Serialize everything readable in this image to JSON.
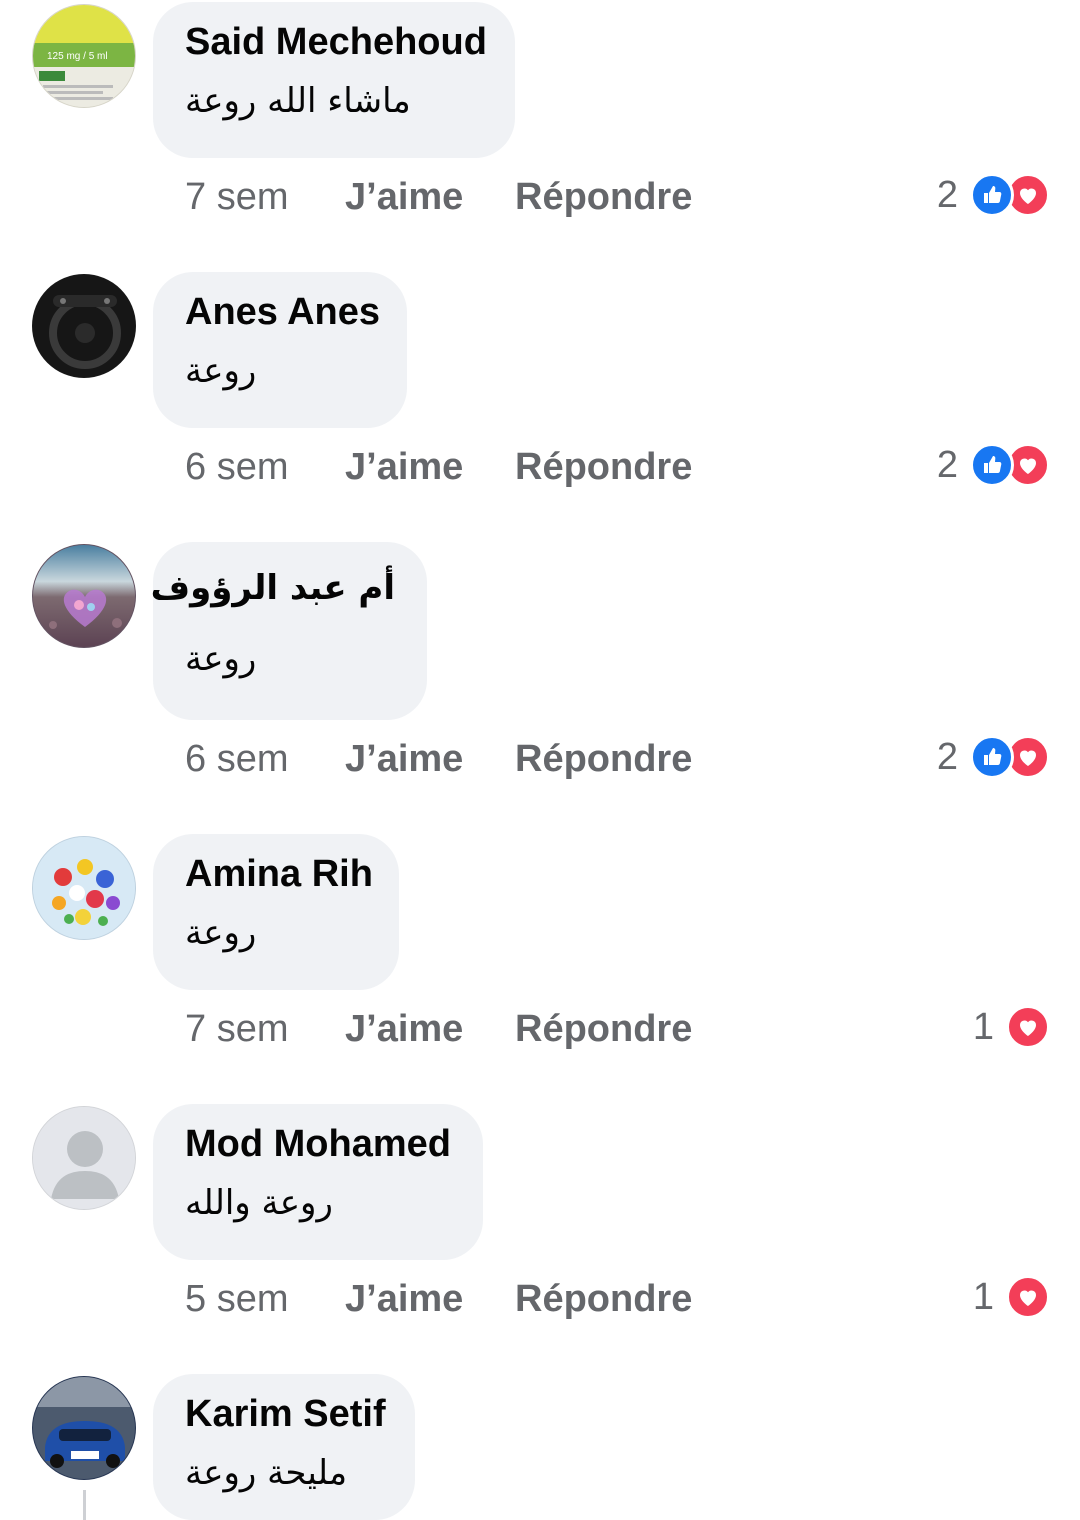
{
  "colors": {
    "bubble_bg": "#f0f2f5",
    "meta_text": "#65676b",
    "like_blue": "#1877f2",
    "love_red": "#f33e58"
  },
  "comments": [
    {
      "author": "Said Mechehoud",
      "text": "ماشاء الله روعة",
      "time": "7 sem",
      "like_label": "J’aime",
      "reply_label": "Répondre",
      "reaction_count": "2",
      "reactions": [
        "like-icon",
        "love-icon"
      ],
      "avatar": "medicine-box-avatar",
      "avatar_text": "125 mg / 5 ml"
    },
    {
      "author": "Anes Anes",
      "text": "روعة",
      "time": "6 sem",
      "like_label": "J’aime",
      "reply_label": "Répondre",
      "reaction_count": "2",
      "reactions": [
        "like-icon",
        "love-icon"
      ],
      "avatar": "car-interior-avatar"
    },
    {
      "author": "أم عبد الرؤوف",
      "text": "روعة",
      "time": "6 sem",
      "like_label": "J’aime",
      "reply_label": "Répondre",
      "reaction_count": "2",
      "reactions": [
        "like-icon",
        "love-icon"
      ],
      "avatar": "heart-stone-beach-avatar"
    },
    {
      "author": "Amina Rih",
      "text": "روعة",
      "time": "7 sem",
      "like_label": "J’aime",
      "reply_label": "Répondre",
      "reaction_count": "1",
      "reactions": [
        "love-icon"
      ],
      "avatar": "flower-bouquet-avatar"
    },
    {
      "author": "Mod Mohamed",
      "text": "روعة والله",
      "time": "5 sem",
      "like_label": "J’aime",
      "reply_label": "Répondre",
      "reaction_count": "1",
      "reactions": [
        "love-icon"
      ],
      "avatar": "default-person-avatar"
    },
    {
      "author": "Karim Setif",
      "text": "مليحة روعة",
      "avatar": "blue-car-avatar"
    }
  ]
}
